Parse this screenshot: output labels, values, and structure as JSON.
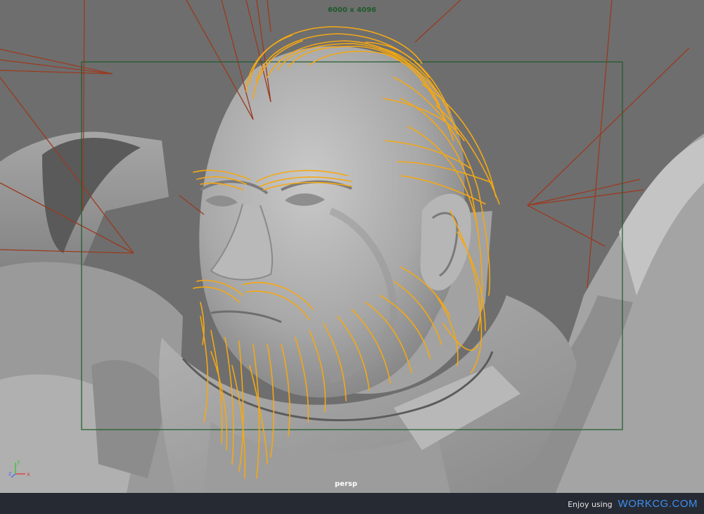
{
  "viewport": {
    "resolution_gate_label": "6000 x 4096",
    "camera_name": "persp",
    "axis_labels": {
      "x": "x",
      "y": "y",
      "z": "z"
    }
  },
  "footer": {
    "enjoy_text": "Enjoy using",
    "brand": "WORKCG.COM"
  },
  "colors": {
    "background": "#6f6f6f",
    "hair_curves": "#f4a814",
    "light_lines": "#9a3a1e",
    "resolution_gate": "#1f5a2c",
    "footer_bg": "#262a33",
    "brand": "#3d8ff0"
  }
}
